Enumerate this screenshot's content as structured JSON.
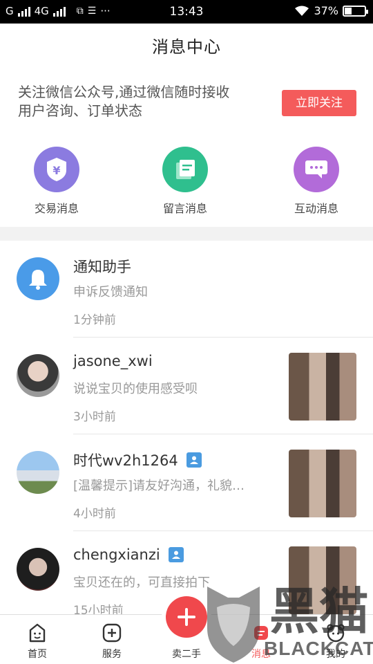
{
  "status_bar": {
    "carrier": "G",
    "network": "4G",
    "time": "13:43",
    "dots": "···",
    "battery": "37%",
    "battery_fraction": 0.37
  },
  "header": {
    "title": "消息中心"
  },
  "banner": {
    "text_line1": "关注微信公众号,通过微信随时接收",
    "text_line2": "用户咨询、订单状态",
    "button": "立即关注",
    "accent": "#f45b5b"
  },
  "categories": [
    {
      "label": "交易消息",
      "icon": "yen-shield-icon",
      "color": "#8b7be0"
    },
    {
      "label": "留言消息",
      "icon": "message-note-icon",
      "color": "#2fbf8e"
    },
    {
      "label": "互动消息",
      "icon": "chat-bubble-icon",
      "color": "#b26bd9"
    }
  ],
  "messages": [
    {
      "name": "通知助手",
      "preview": "申诉反馈通知",
      "time": "1分钟前",
      "avatar": "bell-icon",
      "thumb": false,
      "verified": false
    },
    {
      "name": "jasone_xwi",
      "preview": "说说宝贝的使用感受呗",
      "time": "3小时前",
      "avatar": "user-photo",
      "thumb": true,
      "verified": false
    },
    {
      "name": "时代wv2h1264",
      "preview": "[温馨提示]请友好沟通，礼貌…",
      "time": "4小时前",
      "avatar": "castle-photo",
      "thumb": true,
      "verified": true
    },
    {
      "name": "chengxianzi",
      "preview": "宝贝还在的，可直接拍下",
      "time": "15小时前",
      "avatar": "user-photo",
      "thumb": true,
      "verified": true
    }
  ],
  "tabbar": {
    "tabs": [
      {
        "label": "首页",
        "icon": "home-face-icon"
      },
      {
        "label": "服务",
        "icon": "plus-square-icon"
      },
      {
        "label": "卖二手",
        "icon": "plus-circle-icon"
      },
      {
        "label": "消息",
        "icon": "message-icon"
      },
      {
        "label": "我的",
        "icon": "profile-icon"
      }
    ],
    "active_index": 3
  },
  "watermark": {
    "brand": "BLACKCAT",
    "cn": "黑猫"
  }
}
